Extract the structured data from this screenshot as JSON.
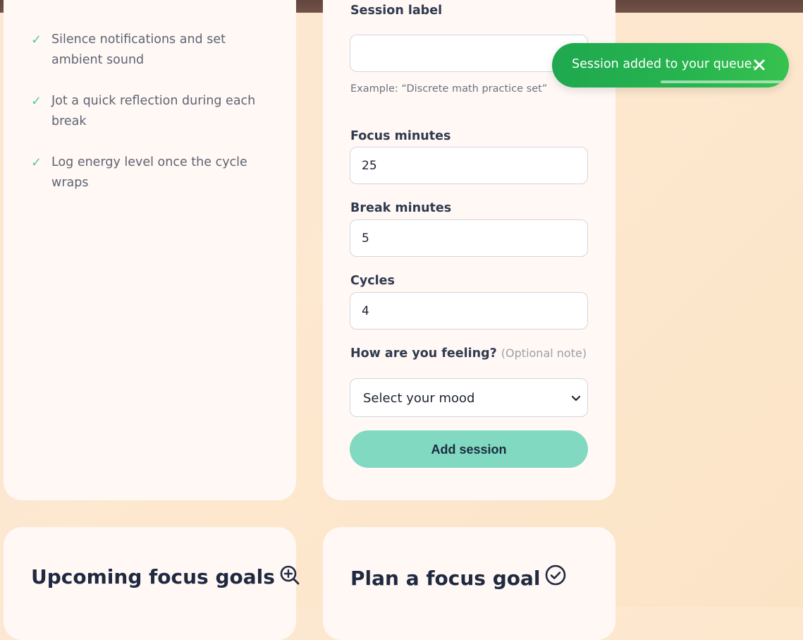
{
  "checklist": {
    "items": [
      {
        "text": "Silence notifications and set ambient sound"
      },
      {
        "text": "Jot a quick reflection during each break"
      },
      {
        "text": "Log energy level once the cycle wraps"
      }
    ]
  },
  "form": {
    "session_label": {
      "label": "Session label",
      "value": "",
      "hint": "Example: “Discrete math practice set”"
    },
    "focus_minutes": {
      "label": "Focus minutes",
      "value": "25"
    },
    "break_minutes": {
      "label": "Break minutes",
      "value": "5"
    },
    "cycles": {
      "label": "Cycles",
      "value": "4"
    },
    "mood": {
      "label": "How are you feeling?",
      "optional": "(Optional note)",
      "selected": "Select your mood"
    },
    "submit_label": "Add session"
  },
  "sections": {
    "upcoming_goals_title": "Upcoming focus goals",
    "plan_goal_title": "Plan a focus goal"
  },
  "toast": {
    "message": "Session added to your queue.",
    "progress": 0.52
  },
  "colors": {
    "accent": "#80d9c0",
    "check": "#57c9a2",
    "toast": "#27b54f",
    "card": "#fff8f5"
  }
}
